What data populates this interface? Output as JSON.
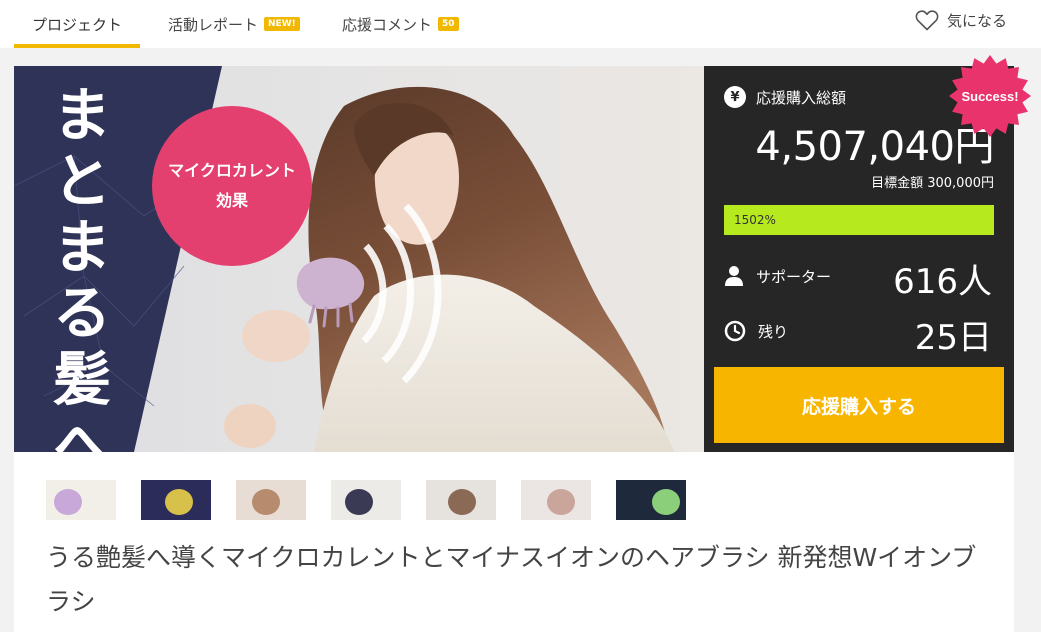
{
  "nav": {
    "tabs": [
      {
        "label": "プロジェクト",
        "badge": ""
      },
      {
        "label": "活動レポート",
        "badge": "NEW!"
      },
      {
        "label": "応援コメント",
        "badge": "50"
      }
    ],
    "favorite_label": "気になる"
  },
  "hero": {
    "vertical_text": [
      "ま",
      "と",
      "ま",
      "る",
      "髪",
      "へ"
    ],
    "circle_line1": "マイクロカレント",
    "circle_line2": "効果"
  },
  "stats": {
    "total_label": "応援購入総額",
    "total_value": "4,507,040円",
    "goal_text": "目標金額 300,000円",
    "progress_text": "1502%",
    "progress_fraction": 1.0,
    "supporters_label": "サポーター",
    "supporters_value": "616人",
    "remaining_label": "残り",
    "remaining_value": "25日",
    "buy_label": "応援購入する",
    "success_label": "Success!",
    "yen_symbol": "¥"
  },
  "thumbnails": [
    {
      "name": "thumbnail-1",
      "colors": [
        "#f2efe9",
        "#c7a8d9"
      ]
    },
    {
      "name": "thumbnail-2",
      "colors": [
        "#2c2c5a",
        "#d7c14a"
      ]
    },
    {
      "name": "thumbnail-3",
      "colors": [
        "#e8ddd5",
        "#b78b6e"
      ]
    },
    {
      "name": "thumbnail-4",
      "colors": [
        "#ecebe8",
        "#3a3a55"
      ]
    },
    {
      "name": "thumbnail-5",
      "colors": [
        "#e6e3df",
        "#8a6a55"
      ]
    },
    {
      "name": "thumbnail-6",
      "colors": [
        "#ebe5e3",
        "#c9a59c"
      ]
    },
    {
      "name": "thumbnail-7",
      "colors": [
        "#1e2a3c",
        "#8ccf7a"
      ]
    }
  ],
  "title": "うる艶髪へ導くマイクロカレントとマイナスイオンのヘアブラシ 新発想Wイオンブラシ",
  "colors": {
    "accent": "#f2b800",
    "panel_bg": "#262626",
    "progress": "#b6ea1f",
    "buy_button": "#f7b500",
    "success_badge": "#e8336d",
    "hero_circle": "#e4406f"
  }
}
